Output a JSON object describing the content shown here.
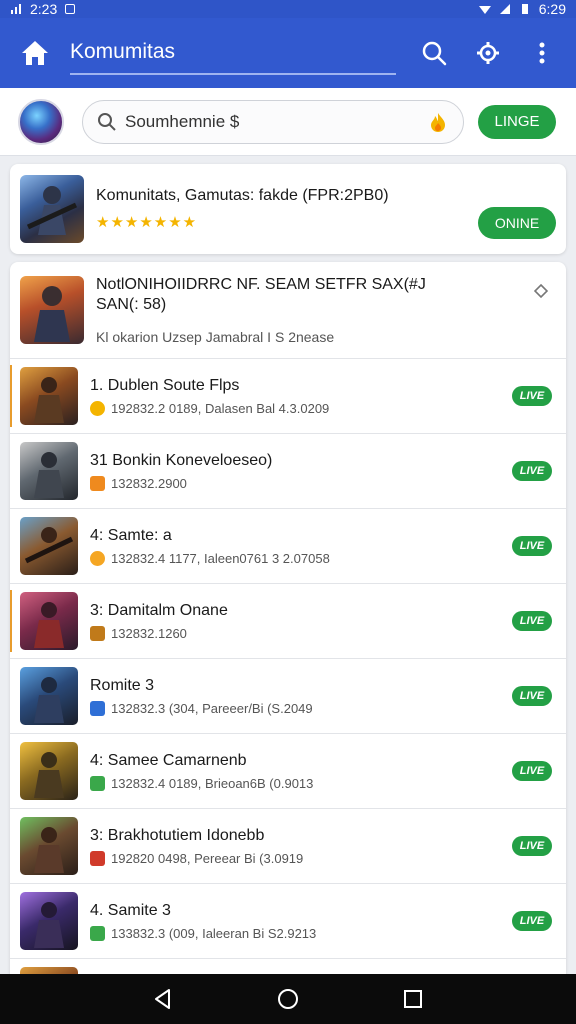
{
  "status_bar": {
    "time_left": "2:23",
    "time_right": "6:29"
  },
  "app_bar": {
    "title": "Komumitas"
  },
  "search": {
    "placeholder": "Soumhemnie $",
    "live_label": "LINGE"
  },
  "featured": {
    "title": "Komunitats, Gamutas: fakde (FPR:2PB0)",
    "stars": "★★★★★★★",
    "button_label": "ONINE"
  },
  "header_item": {
    "title": "NotlONIHOIIDRRC NF. SEAM SETFR SAX(#J SAN(: 58)",
    "subtitle": "Kl okarion Uzsep Jamabral I S 2nease"
  },
  "items": [
    {
      "title": "1. Dublen Soute Flps",
      "sub": "192832.2 0189, Dalasen Bal 4.3.0209",
      "live": "LIVE"
    },
    {
      "title": "31 Bonkin Koneveloeseo)",
      "sub": "132832.2900",
      "live": "LIVE"
    },
    {
      "title": "4:  Samte: a",
      "sub": "132832.4 1177, Ialeen0761 3 2.07058",
      "live": "LIVE"
    },
    {
      "title": "3:  Damitalm Onane",
      "sub": "132832.1260",
      "live": "LIVE"
    },
    {
      "title": "Romite 3",
      "sub": "132832.3 (304, Pareeer/Bi (S.2049",
      "live": "LIVE"
    },
    {
      "title": "4:  Samee Camarnenb",
      "sub": "132832.4 0189, Brieoan6B (0.9013",
      "live": "LIVE"
    },
    {
      "title": "3:  Brakhotutiem Idonebb",
      "sub": "192820 0498, Pereear Bi (3.0919",
      "live": "LIVE"
    },
    {
      "title": "4.  Samite 3",
      "sub": "133832.3 (009, Ialeeran Bi S2.9213",
      "live": "LIVE"
    }
  ],
  "colors": {
    "appbar": "#3259cf",
    "green": "#23a045",
    "star": "#f4b400"
  }
}
